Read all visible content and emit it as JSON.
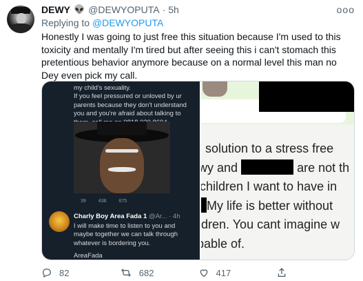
{
  "tweet": {
    "display_name": "DEWY",
    "emoji": "👽",
    "handle": "@DEWYOPUTA",
    "dot": "·",
    "time": "5h",
    "more": "ooo",
    "reply_prefix": "Replying to",
    "reply_handle": "@DEWYOPUTA",
    "text": "Honestly I was going to just free this situation because I'm used to this toxicity and mentally I'm tired but after seeing this i can't stomach this pretentious behavior anymore because on a normal level this man no Dey even pick my call."
  },
  "media": {
    "left": {
      "top_text": "my child's sexuality.\nIf you feel pressured or unloved by ur parents because they don't understand you and you're afraid about talking to them, call me on 0818 020 8694.",
      "mini_stats": [
        "39",
        "438",
        "675"
      ],
      "author_name": "Charly Boy Area Fada 1",
      "author_meta": "@Ar... · 4h",
      "reply_text": "I will make time to listen to you and maybe together we can talk through whatever is bordering you.",
      "signature": "AreaFada"
    },
    "right": {
      "lines": [
        "solution to a stress free",
        "wy and",
        "are not th",
        "children I want to have in",
        "My life is better without",
        "ldren. You cant imagine w",
        "pable of."
      ]
    }
  },
  "actions": {
    "replies": "82",
    "retweets": "682",
    "likes": "417"
  },
  "colors": {
    "accent": "#1d9bf0",
    "muted": "#536471",
    "text": "#0f1419"
  }
}
